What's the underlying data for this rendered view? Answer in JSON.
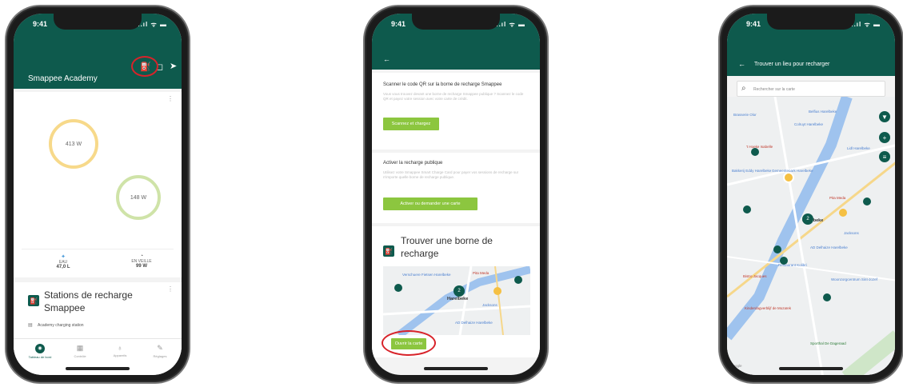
{
  "status": {
    "time": "9:41",
    "signal": "..ıl ᯤ ▬"
  },
  "phone1": {
    "app_title": "Smappee Academy",
    "menu_dots": "⋮",
    "ring1_value": "413 W",
    "ring2_value": "148 W",
    "stat1_label": "EAU",
    "stat1_value": "47,0 L",
    "stat2_label": "EN VEILLE",
    "stat2_value": "99 W",
    "station_title": "Stations de recharge Smappee",
    "station_item": "Academy charging station",
    "tabs": [
      {
        "label": "Tableau de bord",
        "icon": "dashboard-icon"
      },
      {
        "label": "Contrôle",
        "icon": "control-icon"
      },
      {
        "label": "Appareils",
        "icon": "bulb-icon"
      },
      {
        "label": "Réglages",
        "icon": "wrench-icon"
      }
    ]
  },
  "phone2": {
    "scan_title": "Scanner le code QR sur la borne de recharge Smappee",
    "scan_text": "Vous vous trouvez devant une borne de recharge Smappee publique ? Scannez le code QR et payez votre session avec votre carte de crédit.",
    "scan_button": "Scannez et chargez",
    "public_title": "Activer la recharge publique",
    "public_text": "Utilisez votre Smappee Smart Charge Card pour payer vos sessions de recharge sur n'importe quelle borne de recharge publique.",
    "public_button": "Activer ou demander une carte",
    "find_title": "Trouver une borne de recharge",
    "open_map_button": "Ouvrir la carte",
    "map_labels": {
      "place1": "Verschuere Fietsen Harelbeke",
      "place2": "Pita Meda",
      "town": "Harelbeke",
      "street": "AD Delhaize Harelbeke",
      "place3": "Jacksons",
      "cluster": "2"
    }
  },
  "phone3": {
    "title": "Trouver un lieu pour recharger",
    "search_placeholder": "Rechercher sur la carte",
    "map_labels": {
      "a": "Brasserie Olor",
      "b": "Belfius Harelbeke",
      "c": "Colruyt Harelbeke",
      "d": "'t Hoeke Isabelle",
      "e": "Bakkerij Eddy Harelbeke",
      "f": "Gemeentepark Harelbeke",
      "g": "Harelbeke",
      "h": "AD Delhaize Harelbeke",
      "i": "Restaurant Kolibri",
      "j": "Bistro Jacques",
      "k": "Woonzorgcentrum Sint-Jozef",
      "l": "Kinderdagverblijf de Mozaïek",
      "m": "Sporthal De Dageraad",
      "n": "Lidl Harelbeke",
      "o": "Pita Meda",
      "p": "Jacksons",
      "q": "Google",
      "cluster": "2"
    }
  }
}
